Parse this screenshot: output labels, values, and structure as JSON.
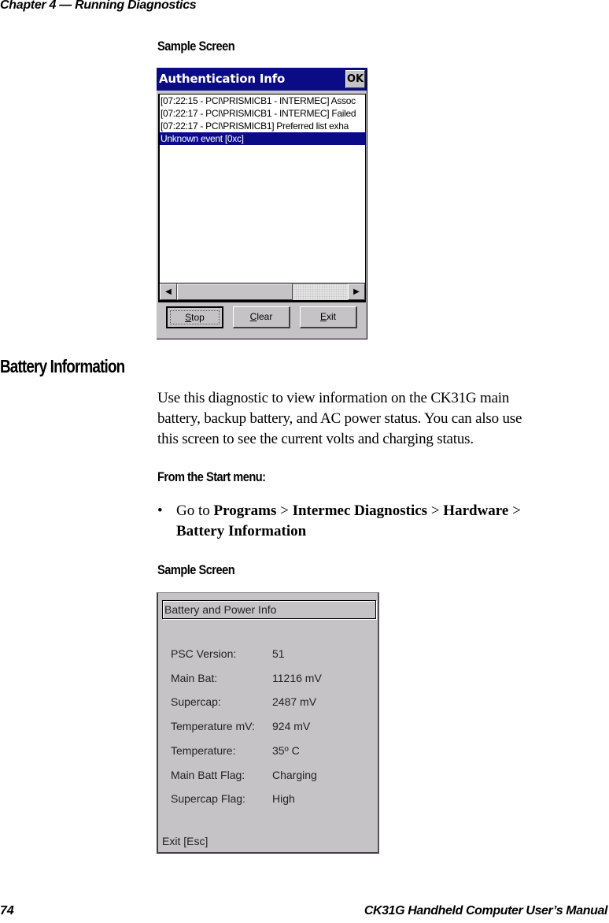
{
  "page": {
    "chapter_header": "Chapter 4 — Running Diagnostics",
    "footer_page_number": "74",
    "footer_title": "CK31G Handheld Computer User’s Manual"
  },
  "sample_screen_1": {
    "heading": "Sample Screen",
    "window_title": "Authentication Info",
    "ok_label": "OK",
    "log_rows": [
      {
        "text": "[07:22:15 - PCI\\PRISMICB1 - INTERMEC]  Assoc",
        "selected": false
      },
      {
        "text": "[07:22:17 - PCI\\PRISMICB1 - INTERMEC]  Failed",
        "selected": false
      },
      {
        "text": "[07:22:17 - PCI\\PRISMICB1]  Preferred list exha",
        "selected": false
      },
      {
        "text": "Unknown event [0xc]",
        "selected": true
      }
    ],
    "buttons": {
      "stop": {
        "accel": "S",
        "rest": "top"
      },
      "clear": {
        "accel": "C",
        "rest": "lear"
      },
      "exit": {
        "accel": "E",
        "rest": "xit"
      }
    },
    "colors": {
      "title_bar": "#0b0b86",
      "selection": "#0b0b86",
      "face": "#c6c3c6"
    }
  },
  "section": {
    "title": "Battery Information",
    "body_lines": [
      "Use this diagnostic to view information on the CK31G main",
      "battery, backup battery, and AC power status. You can also use",
      "this screen to see the current volts and charging status."
    ],
    "menu_heading": "From the Start menu:",
    "bullet": {
      "prefix": "Go to ",
      "path": [
        "Programs",
        "Intermec Diagnostics",
        "Hardware",
        "Battery Information"
      ],
      "separator": " > "
    }
  },
  "sample_screen_2": {
    "heading": "Sample Screen",
    "title": "Battery and Power Info",
    "rows": [
      {
        "label": "PSC Version:",
        "value": "51"
      },
      {
        "label": "Main Bat:",
        "value": "11216 mV"
      },
      {
        "label": "Supercap:",
        "value": "2487 mV"
      },
      {
        "label": "Temperature mV:",
        "value": "924 mV"
      },
      {
        "label": "Temperature:",
        "value": "35º C"
      },
      {
        "label": "Main Batt Flag:",
        "value": "Charging"
      },
      {
        "label": "Supercap Flag:",
        "value": "High"
      }
    ],
    "exit_label": "Exit [Esc]"
  }
}
